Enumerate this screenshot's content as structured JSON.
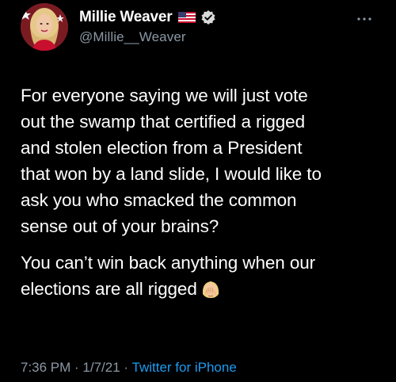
{
  "user": {
    "name": "Millie Weaver",
    "handle": "@Millie__Weaver",
    "verified": true,
    "flag_icon": "us-flag-icon"
  },
  "tweet": {
    "paragraph_1": "For everyone saying we will just vote\nout the swamp that certified a rigged\nand stolen election from a President\nthat won by a land slide, I would like to\nask you who smacked the common\nsense out of your brains?",
    "paragraph_2": "You can’t win back anything when our\nelections are all rigged",
    "emoji_icon": "woman-facepalming-emoji"
  },
  "meta": {
    "time": "7:36 PM",
    "separator_1": " · ",
    "date": "1/7/21",
    "separator_2": " · ",
    "source": "Twitter for iPhone"
  },
  "colors": {
    "background": "#000000",
    "text": "#ffffff",
    "secondary": "#8b98a5",
    "link": "#1d9bf0"
  }
}
